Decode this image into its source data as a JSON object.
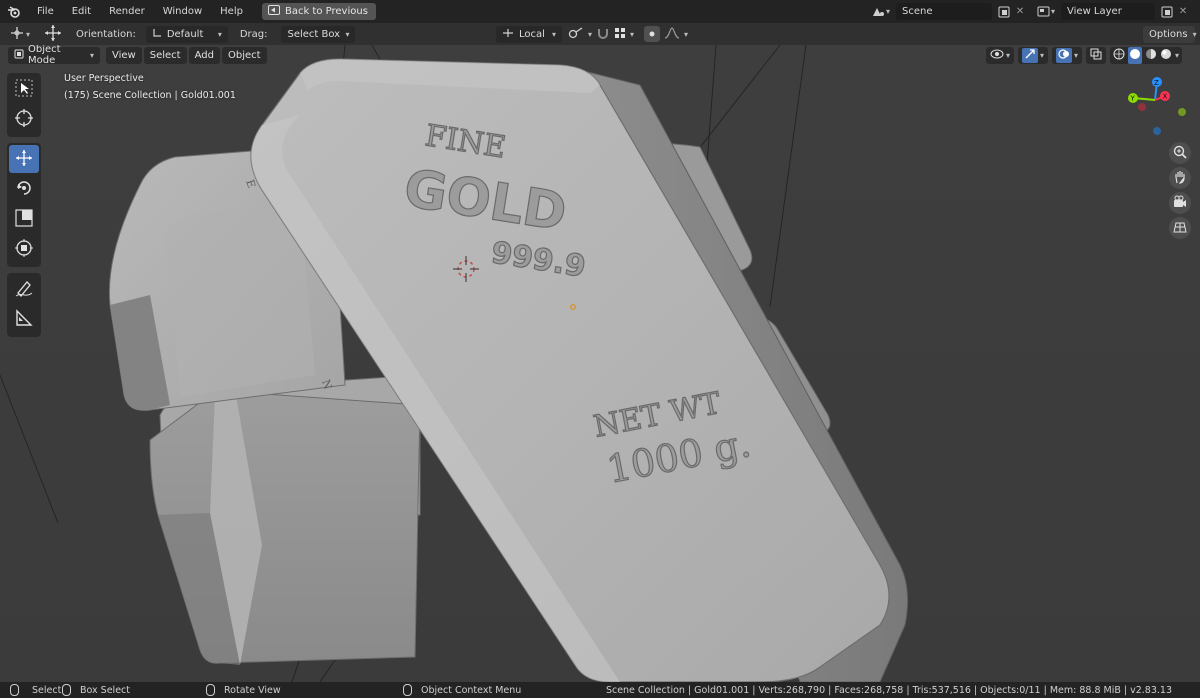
{
  "menu": {
    "items": [
      "File",
      "Edit",
      "Render",
      "Window",
      "Help"
    ],
    "back_button": "Back to Previous",
    "scene_label": "Scene",
    "view_layer_label": "View Layer"
  },
  "tool_header": {
    "orientation_label": "Orientation:",
    "orientation_value": "Default",
    "drag_label": "Drag:",
    "drag_value": "Select Box",
    "pivot_value": "Local",
    "options_label": "Options"
  },
  "viewport": {
    "mode": "Object Mode",
    "menus": [
      "View",
      "Select",
      "Add",
      "Object"
    ],
    "perspective_text": "User Perspective",
    "collection_text": "(175) Scene Collection | Gold01.001",
    "bar_text": {
      "line1": "FINE",
      "line2": "GOLD",
      "line3": "999.9",
      "line4": "NET WT",
      "line5": "1000 g."
    },
    "gizmo_axes": [
      "Z",
      "X",
      "Y"
    ]
  },
  "status": {
    "select": "Select",
    "box_select": "Box Select",
    "rotate_view": "Rotate View",
    "context_menu": "Object Context Menu",
    "stats": "Scene Collection | Gold01.001 | Verts:268,790 | Faces:268,758 | Tris:537,516 | Objects:0/11 | Mem: 88.8 MiB | v2.83.13"
  },
  "colors": {
    "accent": "#4772b3",
    "header_bg": "#303030",
    "topbar_bg": "#232323",
    "viewport_bg": "#3d3d3d",
    "axis_x": "#ff3352",
    "axis_y": "#8bdc00",
    "axis_z": "#2890ff"
  },
  "icons": [
    "blender-logo-icon",
    "back-icon",
    "scene-icon",
    "view-layer-icon",
    "transform-icon",
    "cursor-icon",
    "move-icon",
    "rotate-icon",
    "scale-icon",
    "transform-all-icon",
    "annotate-icon",
    "measure-icon",
    "zoom-icon",
    "hand-icon",
    "camera-icon",
    "grid-icon"
  ]
}
